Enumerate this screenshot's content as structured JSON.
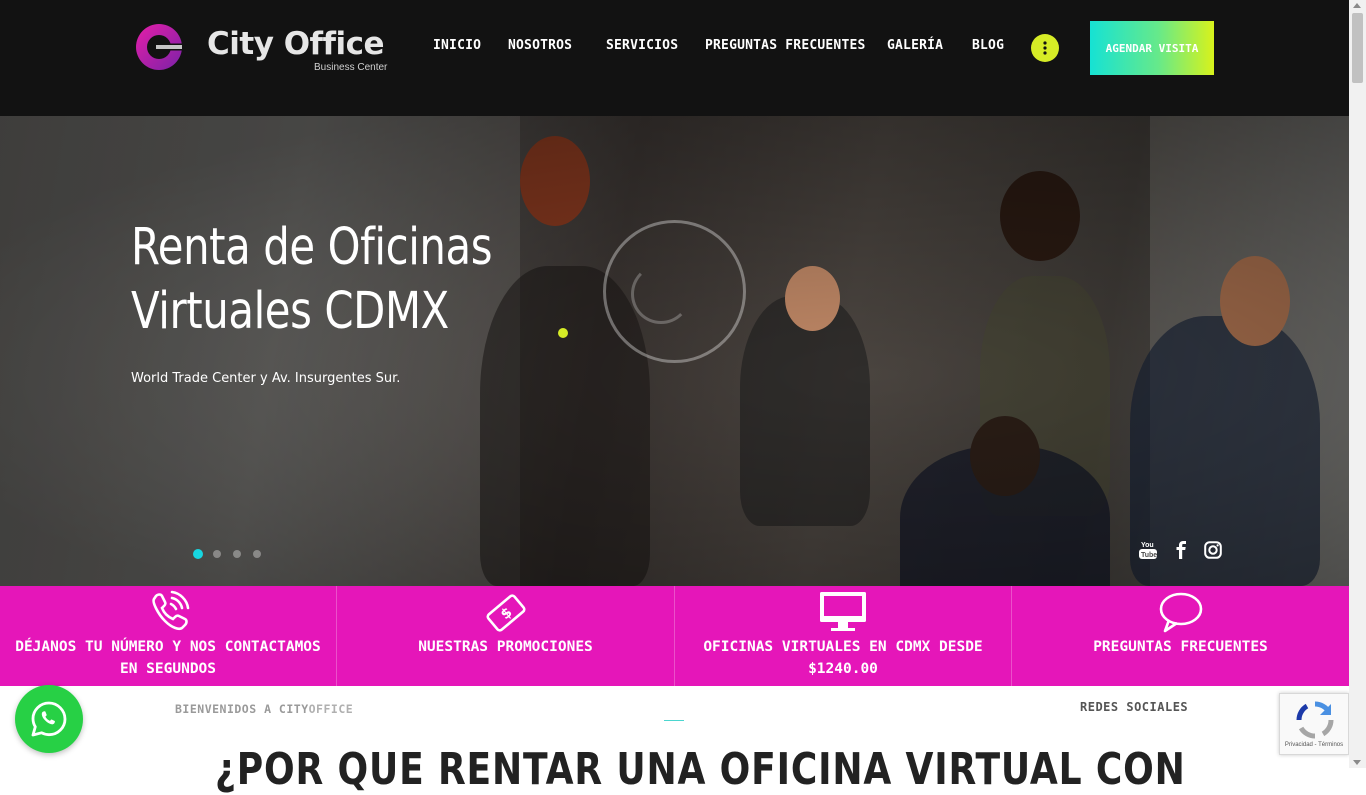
{
  "brand": {
    "name": "City Office",
    "tagline": "Business Center",
    "colors": {
      "accent_pink": "#e516b9",
      "accent_lime": "#d6ec26",
      "accent_cyan": "#17d6e0",
      "header_bg": "#121212"
    }
  },
  "nav": {
    "items": [
      {
        "label": "INICIO"
      },
      {
        "label": "NOSOTROS"
      },
      {
        "label": "SERVICIOS"
      },
      {
        "label": "PREGUNTAS FRECUENTES"
      },
      {
        "label": "GALERÍA"
      },
      {
        "label": "BLOG"
      }
    ],
    "more_icon": "vertical-dots-icon",
    "cta_label": "AGENDAR VISITA"
  },
  "hero": {
    "title": "Renta de Oficinas Virtuales CDMX",
    "subtitle": "World Trade Center y Av. Insurgentes Sur.",
    "slides_count": 4,
    "active_slide": 1,
    "social": [
      {
        "icon": "youtube-icon",
        "text": "You Tube"
      },
      {
        "icon": "facebook-icon",
        "text": "f"
      },
      {
        "icon": "instagram-icon",
        "text": ""
      }
    ]
  },
  "features": [
    {
      "icon": "phone-icon",
      "label": "DÉJANOS TU NÚMERO Y NOS CONTACTAMOS EN SEGUNDOS"
    },
    {
      "icon": "money-icon",
      "label": "NUESTRAS PROMOCIONES"
    },
    {
      "icon": "monitor-icon",
      "label": "OFICINAS VIRTUALES EN CDMX DESDE $1240.00"
    },
    {
      "icon": "chat-bubble-icon",
      "label": "PREGUNTAS FRECUENTES"
    }
  ],
  "welcome": {
    "prefix": "BIENVENIDOS A CITY",
    "accent": "OFFICE",
    "redes_label": "REDES SOCIALES",
    "heading": "¿POR QUE RENTAR UNA OFICINA VIRTUAL CON"
  },
  "floating": {
    "whatsapp_icon": "whatsapp-icon",
    "recaptcha_text": "Privacidad - Términos"
  }
}
